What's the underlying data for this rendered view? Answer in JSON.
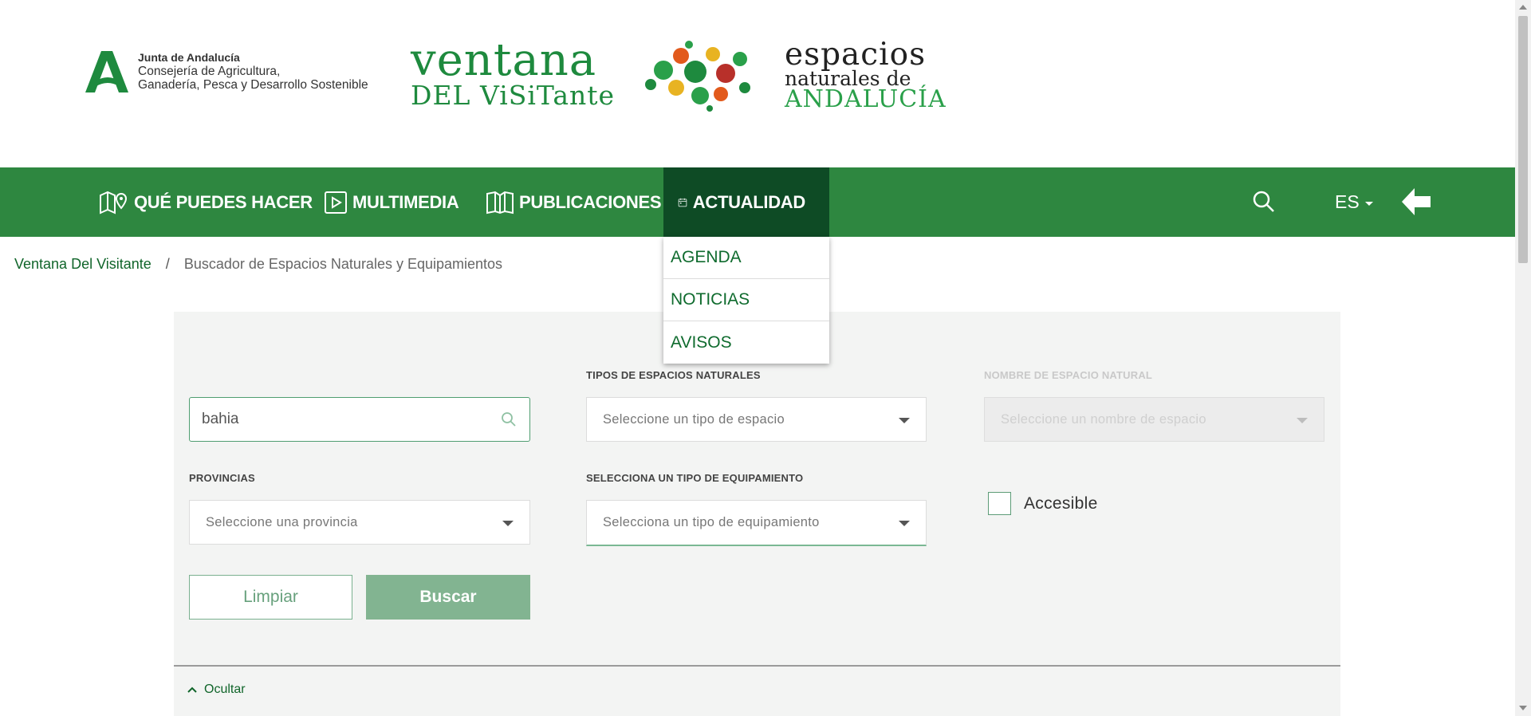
{
  "header": {
    "junta": {
      "line1": "Junta de Andalucía",
      "line2": "Consejería de Agricultura,",
      "line3": "Ganadería, Pesca y Desarrollo Sostenible"
    },
    "ventana": {
      "line1": "ventana",
      "line2": "DEL ViSiTante"
    },
    "espacios": {
      "line1": "espacios",
      "line2": "naturales de",
      "line3": "ANDALUCÍA"
    }
  },
  "nav": {
    "items": [
      {
        "label": "QUÉ PUEDES HACER",
        "icon": "map-pin-icon"
      },
      {
        "label": "MULTIMEDIA",
        "icon": "play-icon"
      },
      {
        "label": "PUBLICACIONES",
        "icon": "book-icon"
      },
      {
        "label": "ACTUALIDAD",
        "icon": "calendar-icon",
        "active": true
      }
    ],
    "lang": "ES",
    "dropdown": [
      "AGENDA",
      "NOTICIAS",
      "AVISOS"
    ]
  },
  "breadcrumb": {
    "home": "Ventana Del Visitante",
    "separator": "/",
    "current": "Buscador de Espacios Naturales y Equipamientos"
  },
  "filters": {
    "search_value": "bahia",
    "tipos_label": "TIPOS DE ESPACIOS NATURALES",
    "tipos_placeholder": "Seleccione un tipo de espacio",
    "nombre_label": "NOMBRE DE ESPACIO NATURAL",
    "nombre_placeholder": "Seleccione un nombre de espacio",
    "provincias_label": "PROVINCIAS",
    "provincias_placeholder": "Seleccione una provincia",
    "equip_label": "SELECCIONA UN TIPO DE EQUIPAMIENTO",
    "equip_placeholder": "Selecciona un tipo de equipamiento",
    "accesible_label": "Accesible",
    "clear_label": "Limpiar",
    "search_label": "Buscar",
    "toggle_label": "Ocultar"
  },
  "colors": {
    "brand_green": "#2e8740",
    "active_green": "#0e4b25",
    "link_green": "#10652a",
    "button_green": "#82b491"
  }
}
